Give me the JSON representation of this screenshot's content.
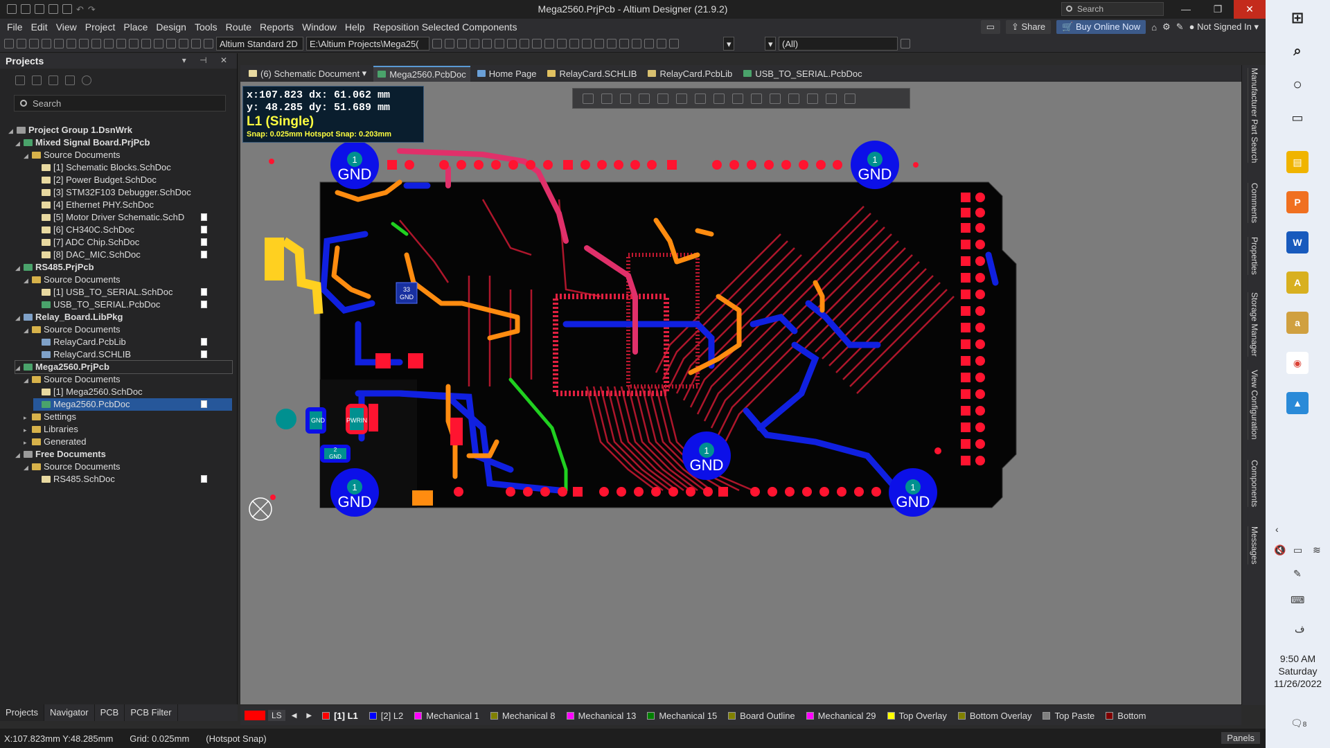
{
  "titlebar": {
    "title": "Mega2560.PrjPcb - Altium Designer (21.9.2)",
    "search_placeholder": "Search"
  },
  "menu": {
    "items": [
      "File",
      "Edit",
      "View",
      "Project",
      "Place",
      "Design",
      "Tools",
      "Route",
      "Reports",
      "Window",
      "Help"
    ],
    "reposition": "Reposition Selected Components",
    "share": "Share",
    "buy": "Buy Online Now",
    "signed": "Not Signed In"
  },
  "toolbar": {
    "view_mode": "Altium Standard 2D",
    "path": "E:\\Altium Projects\\Mega25(",
    "filter": "(All)"
  },
  "projects": {
    "title": "Projects",
    "search": "Search",
    "tree": [
      {
        "label": "Project Group 1.DsnWrk",
        "level": 0,
        "kind": "grp",
        "bold": true
      },
      {
        "label": "Mixed Signal Board.PrjPcb",
        "level": 1,
        "kind": "pcb",
        "bold": true
      },
      {
        "label": "Source Documents",
        "level": 2,
        "kind": "fold"
      },
      {
        "label": "[1] Schematic Blocks.SchDoc",
        "level": 3,
        "kind": "doc"
      },
      {
        "label": "[2] Power Budget.SchDoc",
        "level": 3,
        "kind": "doc"
      },
      {
        "label": "[3] STM32F103 Debugger.SchDoc",
        "level": 3,
        "kind": "doc"
      },
      {
        "label": "[4] Ethernet PHY.SchDoc",
        "level": 3,
        "kind": "doc"
      },
      {
        "label": "[5] Motor Driver Schematic.SchD",
        "level": 3,
        "kind": "doc",
        "badge": true
      },
      {
        "label": "[6] CH340C.SchDoc",
        "level": 3,
        "kind": "doc",
        "badge": true
      },
      {
        "label": "[7] ADC Chip.SchDoc",
        "level": 3,
        "kind": "doc",
        "badge": true
      },
      {
        "label": "[8] DAC_MIC.SchDoc",
        "level": 3,
        "kind": "doc",
        "badge": true
      },
      {
        "label": "RS485.PrjPcb",
        "level": 1,
        "kind": "pcb",
        "bold": true
      },
      {
        "label": "Source Documents",
        "level": 2,
        "kind": "fold"
      },
      {
        "label": "[1] USB_TO_SERIAL.SchDoc",
        "level": 3,
        "kind": "doc",
        "badge": true
      },
      {
        "label": "USB_TO_SERIAL.PcbDoc",
        "level": 3,
        "kind": "pcb",
        "badge": true
      },
      {
        "label": "Relay_Board.LibPkg",
        "level": 1,
        "kind": "lib",
        "bold": true
      },
      {
        "label": "Source Documents",
        "level": 2,
        "kind": "fold"
      },
      {
        "label": "RelayCard.PcbLib",
        "level": 3,
        "kind": "lib",
        "badge": true
      },
      {
        "label": "RelayCard.SCHLIB",
        "level": 3,
        "kind": "lib",
        "badge": true
      },
      {
        "label": "Mega2560.PrjPcb",
        "level": 1,
        "kind": "pcb",
        "bold": true,
        "hl": true
      },
      {
        "label": "Source Documents",
        "level": 2,
        "kind": "fold"
      },
      {
        "label": "[1] Mega2560.SchDoc",
        "level": 3,
        "kind": "doc"
      },
      {
        "label": "Mega2560.PcbDoc",
        "level": 3,
        "kind": "pcb",
        "badge": true,
        "sel": true
      },
      {
        "label": "Settings",
        "level": 2,
        "kind": "fold",
        "collapsed": true
      },
      {
        "label": "Libraries",
        "level": 2,
        "kind": "fold",
        "collapsed": true
      },
      {
        "label": "Generated",
        "level": 2,
        "kind": "fold",
        "collapsed": true
      },
      {
        "label": "Free Documents",
        "level": 1,
        "kind": "grp",
        "bold": true
      },
      {
        "label": "Source Documents",
        "level": 2,
        "kind": "fold"
      },
      {
        "label": "RS485.SchDoc",
        "level": 3,
        "kind": "doc",
        "badge": true
      }
    ],
    "bottom_tabs": [
      "Projects",
      "Navigator",
      "PCB",
      "PCB Filter"
    ]
  },
  "doc_tabs": [
    "(6) Schematic Document",
    "Mega2560.PcbDoc",
    "Home Page",
    "RelayCard.SCHLIB",
    "RelayCard.PcbLib",
    "USB_TO_SERIAL.PcbDoc"
  ],
  "hud": {
    "line1": "x:107.823   dx: 61.062 mm",
    "line2": "y: 48.285   dy: 51.689 mm",
    "layer": "L1 (Single)",
    "snap": "Snap: 0.025mm Hotspot Snap: 0.203mm"
  },
  "board": {
    "gnd": [
      "1",
      "GND"
    ],
    "ic_label": [
      "33",
      "GND"
    ],
    "pwr_label": "PWRIN",
    "pin_small": [
      "2",
      "GND"
    ],
    "pin_small2": [
      "3",
      "GND"
    ]
  },
  "right_tabs": [
    "Manufacturer Part Search",
    "Comments",
    "Properties",
    "Storage Manager",
    "View Configuration",
    "Components",
    "Messages"
  ],
  "layers": {
    "ls": "LS",
    "current": "[1] L1",
    "list": [
      {
        "name": "[2] L2",
        "color": "#0000ff"
      },
      {
        "name": "Mechanical 1",
        "color": "#ff00ff"
      },
      {
        "name": "Mechanical 8",
        "color": "#808000"
      },
      {
        "name": "Mechanical 13",
        "color": "#ff00ff"
      },
      {
        "name": "Mechanical 15",
        "color": "#008000"
      },
      {
        "name": "Board Outline",
        "color": "#808000"
      },
      {
        "name": "Mechanical 29",
        "color": "#ff00ff"
      },
      {
        "name": "Top Overlay",
        "color": "#ffff00"
      },
      {
        "name": "Bottom Overlay",
        "color": "#808000"
      },
      {
        "name": "Top Paste",
        "color": "#808080"
      },
      {
        "name": "Bottom",
        "color": "#800000"
      }
    ],
    "current_color": "#ff0000"
  },
  "status": {
    "coords": "X:107.823mm Y:48.285mm",
    "grid": "Grid: 0.025mm",
    "snap": "(Hotspot Snap)",
    "panels": "Panels"
  },
  "clock": {
    "time": "9:50 AM",
    "day": "Saturday",
    "date": "11/26/2022",
    "notif": "8",
    "lang": "ف"
  }
}
